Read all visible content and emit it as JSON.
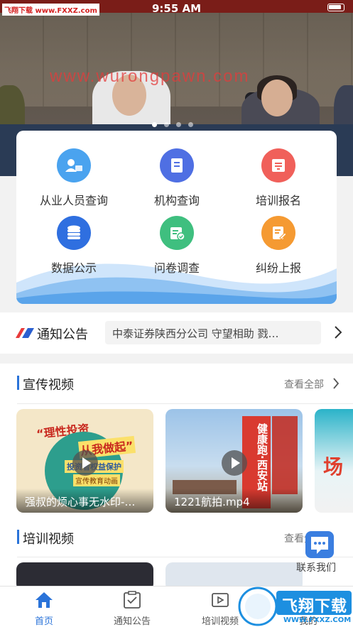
{
  "status_bar": {
    "time": "9:55 AM"
  },
  "source_badge": "飞翔下载 www.FXXZ.com",
  "watermark": "www.wurongpawn.com",
  "banner": {
    "slide_count": 4,
    "active_index": 0
  },
  "menu": {
    "items": [
      {
        "label": "从业人员查询",
        "icon": "person-card-icon",
        "color": "#4aa3ef"
      },
      {
        "label": "机构查询",
        "icon": "building-icon",
        "color": "#4f6fe3"
      },
      {
        "label": "培训报名",
        "icon": "signup-icon",
        "color": "#f0605a"
      },
      {
        "label": "数据公示",
        "icon": "database-icon",
        "color": "#2f6fe0"
      },
      {
        "label": "问卷调查",
        "icon": "questionnaire-icon",
        "color": "#3fbf7f"
      },
      {
        "label": "纠纷上报",
        "icon": "report-icon",
        "color": "#f59a32"
      }
    ]
  },
  "notice": {
    "title": "通知公告",
    "message": "中泰证券陕西分公司 守望相助 戮…"
  },
  "promo_videos": {
    "title": "宣传视频",
    "more": "查看全部",
    "items": [
      {
        "caption": "强叔的烦心事无水印-…",
        "poster_text_1": "“理性投资",
        "poster_text_2": "从我做起”",
        "poster_text_3": "投资者权益保护",
        "poster_text_4": "宣传教育动画"
      },
      {
        "caption": "1221航拍.mp4",
        "poster_text_1": "健康跑·西安站"
      },
      {
        "caption": "场"
      }
    ]
  },
  "training_videos": {
    "title": "培训视频",
    "more": "查看全部"
  },
  "contact": {
    "label": "联系我们"
  },
  "tabbar": {
    "tabs": [
      {
        "label": "首页",
        "active": true
      },
      {
        "label": "通知公告",
        "active": false
      },
      {
        "label": "培训视频",
        "active": false
      },
      {
        "label": "我的",
        "active": false
      }
    ]
  },
  "corner_logo": {
    "text": "飞翔下载",
    "url": "WWW.FXXZ.COM"
  }
}
